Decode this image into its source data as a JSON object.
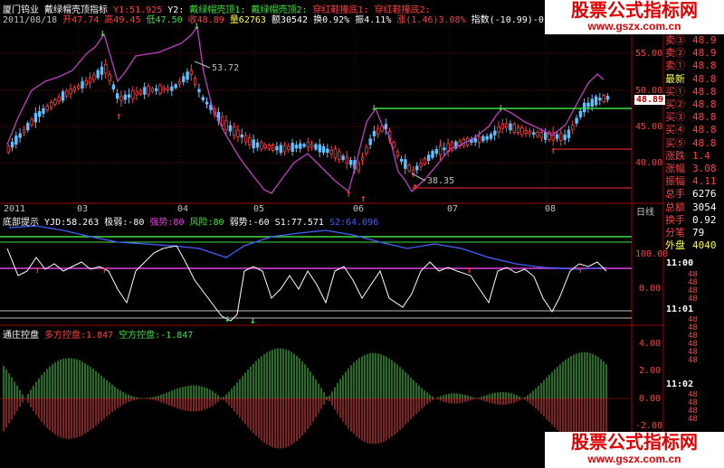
{
  "header": {
    "stock_name": "厦门钨业",
    "indicator_name": "戴绿帽壳顶指标",
    "y1": "Y1:51.925",
    "y2": "Y2:",
    "tag1": "戴绿帽壳顶1:",
    "tag2": "戴绿帽壳顶2:",
    "tag3": "穿红鞋撞底1:",
    "tag4": "穿红鞋撞底2:",
    "date": "2011/08/18",
    "open": "开47.74",
    "high": "高49.45",
    "low": "低47.50",
    "close": "收48.89",
    "volume": "量62763",
    "amount": "额30542",
    "turnover": "换0.92%",
    "amplitude": "振4.11%",
    "change": "涨(1.46)3.08%",
    "index": "指数(-10.99)-0.42%"
  },
  "panel1": {
    "axis_ticks": [
      "55.00",
      "50.00",
      "45.00",
      "40.00"
    ],
    "annotation_high": "53.72",
    "annotation_low": "38.35",
    "current_price": "48.89",
    "months": [
      "2011",
      "03",
      "04",
      "05",
      "06",
      "07",
      "08"
    ],
    "period_label": "日线"
  },
  "panel2": {
    "title": "底部提示",
    "yjd": "YJD:58.263",
    "jr": "极弱:-80",
    "qs": "强势:80",
    "fx": "风险:80",
    "rs": "弱势:-60",
    "s1": "S1:77.571",
    "s2": "S2:64.096",
    "axis_ticks": [
      "100.00",
      "0.00"
    ]
  },
  "panel3": {
    "title": "通庄控盘",
    "bull": "多方控盘:1.847",
    "bear": "空方控盘:-1.847",
    "axis_ticks": [
      "4.00",
      "2.00",
      "0.00",
      "-2.00"
    ]
  },
  "sidebar": {
    "rows": [
      {
        "label": "卖③",
        "value": "48.9"
      },
      {
        "label": "卖②",
        "value": "48.9"
      },
      {
        "label": "卖①",
        "value": "48.8"
      },
      {
        "label": "最新",
        "value": "48.8"
      },
      {
        "label": "买①",
        "value": "48.8"
      },
      {
        "label": "买②",
        "value": "48.8"
      },
      {
        "label": "买③",
        "value": "48.8"
      },
      {
        "label": "买④",
        "value": "48.8"
      },
      {
        "label": "买⑤",
        "value": "48.8"
      },
      {
        "label": "涨跌",
        "value": "1.4"
      },
      {
        "label": "涨幅",
        "value": "3.08"
      },
      {
        "label": "振幅",
        "value": "4.11"
      },
      {
        "label": "总手",
        "value": "6276"
      },
      {
        "label": "总额",
        "value": "3054"
      },
      {
        "label": "换手",
        "value": "0.92"
      },
      {
        "label": "分笔",
        "value": "79"
      },
      {
        "label": "外盘",
        "value": "4040"
      }
    ],
    "times": [
      "11:00",
      "11:01",
      "11:02"
    ]
  },
  "watermark": {
    "title": "股票公式指标网",
    "url": "www.gszx.com.cn"
  },
  "colors": {
    "candle_up": "#ff4040",
    "candle_down": "#60c0ff",
    "ma_line": "#c040c0",
    "green_line": "#40e040",
    "panel_border": "#c00000"
  }
}
